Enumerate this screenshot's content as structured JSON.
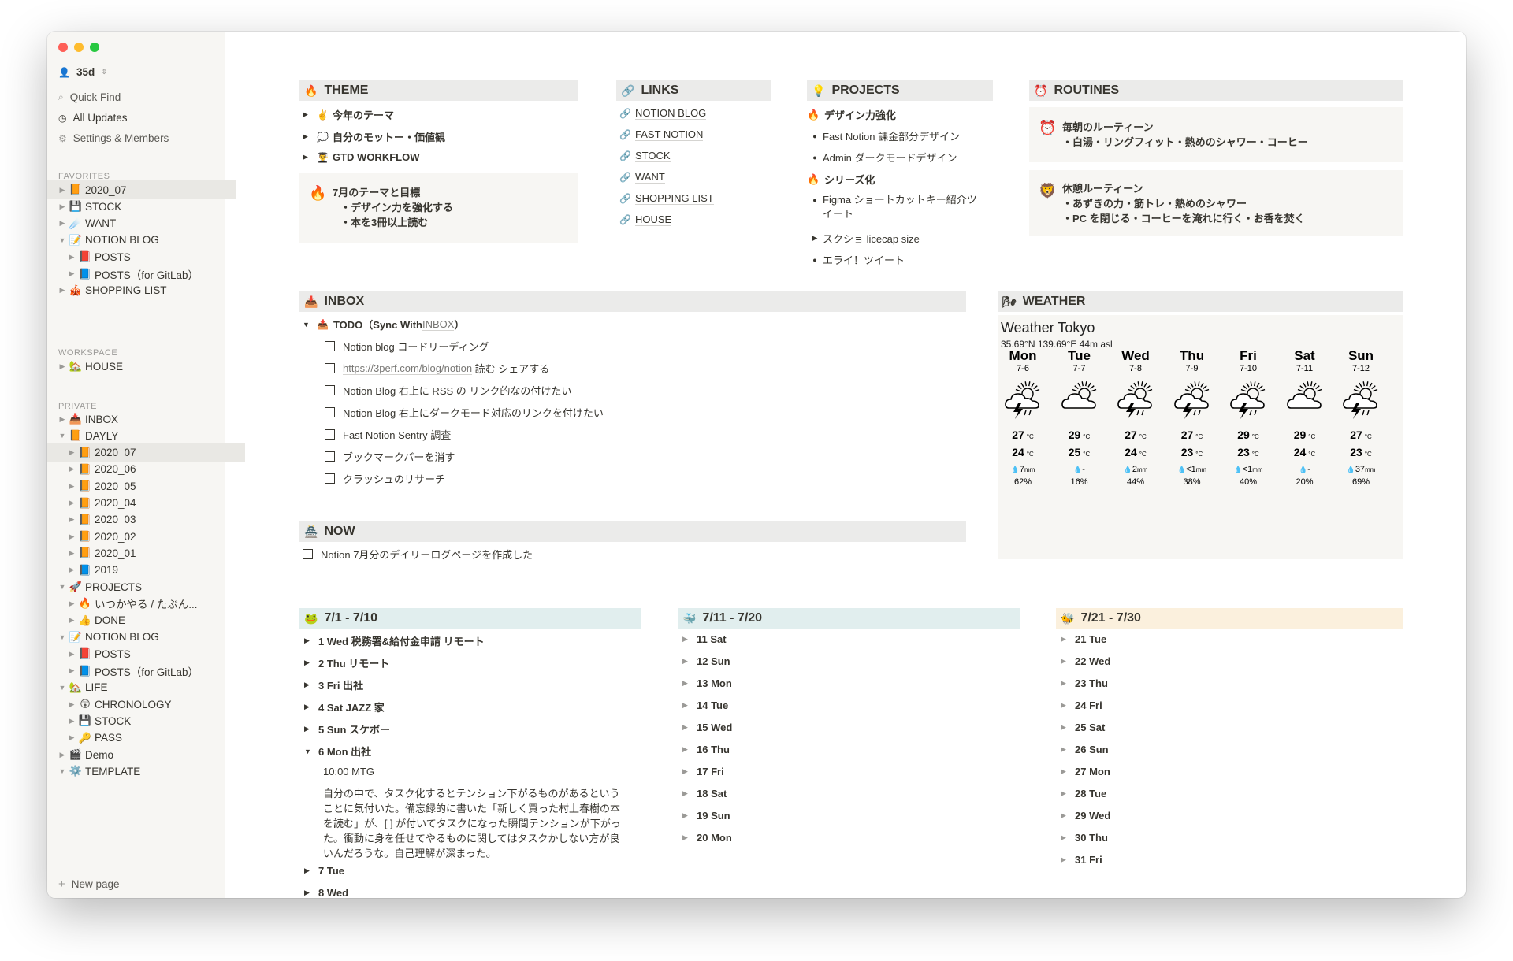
{
  "sidebar": {
    "workspace": "35d",
    "quick_find": "Quick Find",
    "all_updates": "All Updates",
    "settings": "Settings & Members",
    "favorites_title": "FAVORITES",
    "workspace_title": "WORKSPACE",
    "private_title": "PRIVATE",
    "new_page": "New page",
    "favorites": [
      {
        "label": "2020_07",
        "emoji": "📙",
        "tri": "▶"
      },
      {
        "label": "STOCK",
        "emoji": "💾",
        "tri": "▶"
      },
      {
        "label": "WANT",
        "emoji": "☄️",
        "tri": "▶"
      },
      {
        "label": "NOTION BLOG",
        "emoji": "📝",
        "tri": "▼"
      },
      {
        "label": "POSTS",
        "emoji": "📕",
        "tri": "▶"
      },
      {
        "label": "POSTS（for GitLab）",
        "emoji": "📘",
        "tri": "▶"
      },
      {
        "label": "SHOPPING LIST",
        "emoji": "🎪",
        "tri": "▶"
      }
    ],
    "workspace_items": [
      {
        "label": "HOUSE",
        "emoji": "🏡",
        "tri": "▶"
      }
    ],
    "private_items": [
      {
        "label": "INBOX",
        "emoji": "📥",
        "tri": "▶"
      },
      {
        "label": "DAYLY",
        "emoji": "📙",
        "tri": "▼"
      },
      {
        "label": "2020_07",
        "emoji": "📙",
        "tri": "▶"
      },
      {
        "label": "2020_06",
        "emoji": "📙",
        "tri": "▶"
      },
      {
        "label": "2020_05",
        "emoji": "📙",
        "tri": "▶"
      },
      {
        "label": "2020_04",
        "emoji": "📙",
        "tri": "▶"
      },
      {
        "label": "2020_03",
        "emoji": "📙",
        "tri": "▶"
      },
      {
        "label": "2020_02",
        "emoji": "📙",
        "tri": "▶"
      },
      {
        "label": "2020_01",
        "emoji": "📙",
        "tri": "▶"
      },
      {
        "label": "2019",
        "emoji": "📘",
        "tri": "▶"
      },
      {
        "label": "PROJECTS",
        "emoji": "🚀",
        "tri": "▼"
      },
      {
        "label": "いつかやる / たぶん...",
        "emoji": "🔥",
        "tri": "▶"
      },
      {
        "label": "DONE",
        "emoji": "👍",
        "tri": "▶"
      },
      {
        "label": "NOTION BLOG",
        "emoji": "📝",
        "tri": "▼"
      },
      {
        "label": "POSTS",
        "emoji": "📕",
        "tri": "▶"
      },
      {
        "label": "POSTS（for GitLab）",
        "emoji": "📘",
        "tri": "▶"
      },
      {
        "label": "LIFE",
        "emoji": "🏡",
        "tri": "▼"
      },
      {
        "label": "CHRONOLOGY",
        "emoji": "😲",
        "tri": "▶"
      },
      {
        "label": "STOCK",
        "emoji": "💾",
        "tri": "▶"
      },
      {
        "label": "PASS",
        "emoji": "🔑",
        "tri": "▶"
      },
      {
        "label": "Demo",
        "emoji": "🎬",
        "tri": "▶"
      },
      {
        "label": "TEMPLATE",
        "emoji": "⚙️",
        "tri": "▼"
      }
    ]
  },
  "theme": {
    "title": "THEME",
    "emoji": "🔥",
    "items": [
      {
        "emoji": "✌️",
        "label": "今年のテーマ"
      },
      {
        "emoji": "💭",
        "label": "自分のモットー・価値観"
      },
      {
        "emoji": "👨‍🎓",
        "label": "GTD WORKFLOW"
      }
    ],
    "callout_emoji": "🔥",
    "callout_lines": [
      "7月のテーマと目標",
      "・デザイン力を強化する",
      "・本を3冊以上読む"
    ]
  },
  "links": {
    "title": "LINKS",
    "emoji": "🔗",
    "icon": "🔗",
    "items": [
      "NOTION BLOG",
      "FAST NOTION",
      "STOCK",
      "WANT",
      "SHOPPING LIST",
      "HOUSE"
    ]
  },
  "projects": {
    "title": "PROJECTS",
    "emoji": "💡",
    "g1_emoji": "🔥",
    "g1_title": "デザイン力強化",
    "g1_items": [
      "Fast Notion 課金部分デザイン",
      "Admin ダークモードデザイン"
    ],
    "g2_emoji": "🔥",
    "g2_title": "シリーズ化",
    "g2_item1a": "Figma ショートカットキー紹介ツ",
    "g2_item1b": "イート",
    "g2_item2": "スクショ licecap size",
    "g2_item3": "エライ！ツイート",
    "bullet": "●",
    "tri": "▶"
  },
  "routines": {
    "title": "ROUTINES",
    "emoji": "⏰",
    "r1_emoji": "⏰",
    "r1_title": "毎朝のルーティーン",
    "r1_line": "・白湯・リングフィット・熱めのシャワー・コーヒー",
    "r2_emoji": "🦁",
    "r2_title": "休憩ルーティーン",
    "r2_line1": "・あずきの力・筋トレ・熱めのシャワー",
    "r2_line2": "・PC を閉じる・コーヒーを淹れに行く・お香を焚く"
  },
  "inbox": {
    "title": "INBOX",
    "emoji": "📥",
    "todo_emoji": "📥",
    "todo_prefix": "TODO（Sync With ",
    "todo_link": "INBOX",
    "todo_suffix": "）",
    "tasks": [
      "Notion blog コードリーディング",
      "Notion Blog 右上に RSS の リンク的なの付けたい",
      "Notion Blog 右上にダークモード対応のリンクを付けたい",
      "Fast Notion Sentry 調査",
      "ブックマークバーを消す",
      "クラッシュのリサーチ"
    ],
    "task2_link": "https://3perf.com/blog/notion",
    "task2_rest": " 読む シェアする"
  },
  "now": {
    "title": "NOW",
    "emoji": "🏯",
    "task": "Notion 7月分のデイリーログページを作成した"
  },
  "weather": {
    "title": "WEATHER",
    "emoji": "🌬",
    "location": "Weather Tokyo",
    "coords": "35.69°N 139.69°E 44m asl",
    "days": [
      {
        "name": "Mon",
        "date": "7-6",
        "icon": "storm",
        "hi": "27",
        "lo": "24",
        "rain": "7",
        "rain_unit": "mm",
        "prob": "62%"
      },
      {
        "name": "Tue",
        "date": "7-7",
        "icon": "cloud",
        "hi": "29",
        "lo": "25",
        "rain": "-",
        "rain_unit": "",
        "prob": "16%"
      },
      {
        "name": "Wed",
        "date": "7-8",
        "icon": "storm",
        "hi": "27",
        "lo": "24",
        "rain": "2",
        "rain_unit": "mm",
        "prob": "44%"
      },
      {
        "name": "Thu",
        "date": "7-9",
        "icon": "storm",
        "hi": "27",
        "lo": "23",
        "rain": "<1",
        "rain_unit": "mm",
        "prob": "38%"
      },
      {
        "name": "Fri",
        "date": "7-10",
        "icon": "storm",
        "hi": "29",
        "lo": "23",
        "rain": "<1",
        "rain_unit": "mm",
        "prob": "40%"
      },
      {
        "name": "Sat",
        "date": "7-11",
        "icon": "cloud",
        "hi": "29",
        "lo": "24",
        "rain": "-",
        "rain_unit": "",
        "prob": "20%"
      },
      {
        "name": "Sun",
        "date": "7-12",
        "icon": "storm",
        "hi": "27",
        "lo": "23",
        "rain": "37",
        "rain_unit": "mm",
        "prob": "69%"
      }
    ],
    "temp_unit": "°C",
    "drop": "💧"
  },
  "cal1": {
    "title": "7/1 - 7/10",
    "emoji": "🐸",
    "color": "#e1eeee",
    "items": [
      {
        "label": "1 Wed 税務署&給付金申請 リモート",
        "tri": "▶"
      },
      {
        "label": "2 Thu リモート",
        "tri": "▶"
      },
      {
        "label": "3 Fri 出社",
        "tri": "▶"
      },
      {
        "label": "4 Sat JAZZ 家",
        "tri": "▶"
      },
      {
        "label": "5 Sun スケボー",
        "tri": "▶"
      },
      {
        "label": "6 Mon 出社",
        "tri": "▼"
      }
    ],
    "mtg": "10:00 MTG",
    "para": [
      "自分の中で、タスク化するとテンション下がるものがあるという",
      "ことに気付いた。備忘録的に書いた「新しく買った村上春樹の本",
      "を読む」が、[ ] が付いてタスクになった瞬間テンションが下がっ",
      "た。衝動に身を任せてやるものに関してはタスクかしない方が良",
      "いんだろうな。自己理解が深まった。"
    ],
    "after": [
      {
        "label": "7 Tue",
        "tri": "▶"
      },
      {
        "label": "8 Wed",
        "tri": "▶"
      }
    ]
  },
  "cal2": {
    "title": "7/11 - 7/20",
    "emoji": "🐳",
    "color": "#e1eeee",
    "items": [
      "11 Sat",
      "12 Sun",
      "13 Mon",
      "14 Tue",
      "15 Wed",
      "16 Thu",
      "17 Fri",
      "18 Sat",
      "19 Sun",
      "20 Mon"
    ],
    "tri": "▶"
  },
  "cal3": {
    "title": "7/21 - 7/30",
    "emoji": "🐝",
    "color": "#fbf0dd",
    "items": [
      "21 Tue",
      "22 Wed",
      "23 Thu",
      "24 Fri",
      "25 Sat",
      "26 Sun",
      "27 Mon",
      "28 Tue",
      "29 Wed",
      "30 Thu",
      "31 Fri"
    ],
    "tri": "▶"
  }
}
